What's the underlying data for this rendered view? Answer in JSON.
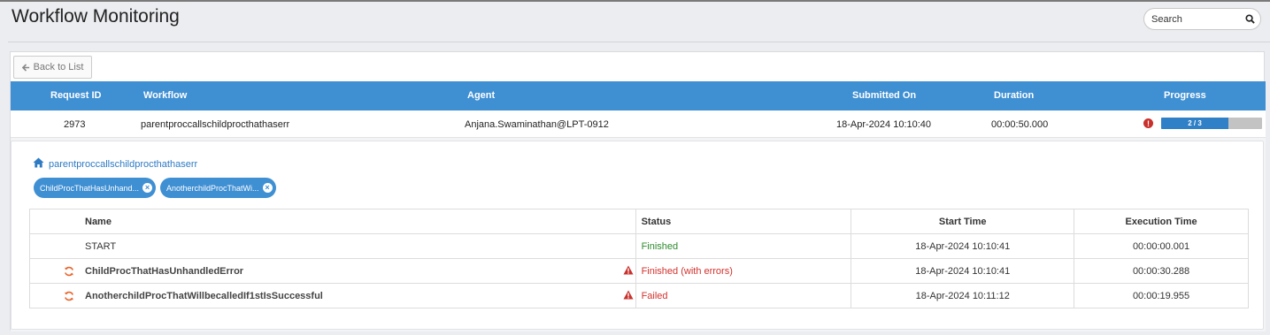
{
  "header": {
    "title": "Workflow Monitoring",
    "search_placeholder": "Search"
  },
  "toolbar": {
    "back_label": "Back to List"
  },
  "grid": {
    "columns": [
      "Request ID",
      "Workflow",
      "Agent",
      "Submitted On",
      "Duration",
      "Progress"
    ],
    "row": {
      "request_id": "2973",
      "workflow": "parentproccallschildprocthathaserr",
      "agent": "Anjana.Swaminathan@LPT-0912",
      "submitted_on": "18-Apr-2024 10:10:40",
      "duration": "00:00:50.000",
      "progress_label": "2 / 3",
      "progress_fraction": 0.667,
      "has_error": true
    }
  },
  "detail": {
    "breadcrumb": "parentproccallschildprocthathaserr",
    "pills": [
      "ChildProcThatHasUnhand...",
      "AnotherchildProcThatWi..."
    ],
    "columns": {
      "name": "Name",
      "status": "Status",
      "start": "Start Time",
      "exec": "Execution Time"
    },
    "steps": [
      {
        "name": "START",
        "status": "Finished",
        "status_kind": "ok",
        "start": "18-Apr-2024 10:10:41",
        "exec": "00:00:00.001",
        "icon": "none",
        "warn": false
      },
      {
        "name": "ChildProcThatHasUnhandledError",
        "status": "Finished (with errors)",
        "status_kind": "bad",
        "start": "18-Apr-2024 10:10:41",
        "exec": "00:00:30.288",
        "icon": "refresh-icon",
        "warn": true
      },
      {
        "name": "AnotherchildProcThatWillbecalledIf1stIsSuccessful",
        "status": "Failed",
        "status_kind": "bad",
        "start": "18-Apr-2024 10:11:12",
        "exec": "00:00:19.955",
        "icon": "refresh-icon",
        "warn": true
      }
    ]
  },
  "colors": {
    "accent": "#3f8fd3",
    "error": "#d2322d",
    "success": "#2e8b2e"
  }
}
